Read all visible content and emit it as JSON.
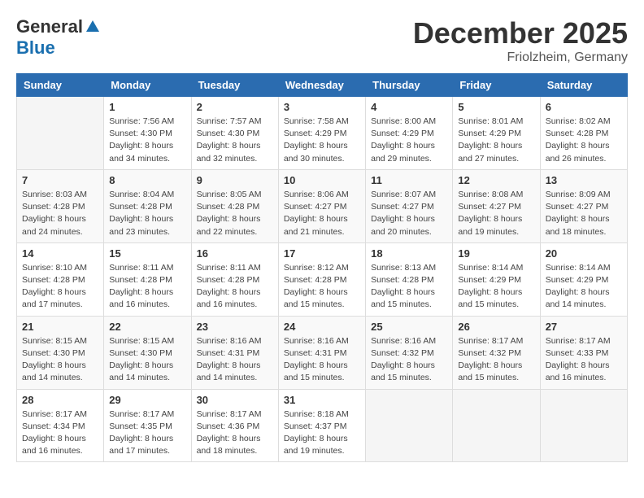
{
  "header": {
    "logo_general": "General",
    "logo_blue": "Blue",
    "month": "December 2025",
    "location": "Friolzheim, Germany"
  },
  "days_of_week": [
    "Sunday",
    "Monday",
    "Tuesday",
    "Wednesday",
    "Thursday",
    "Friday",
    "Saturday"
  ],
  "weeks": [
    [
      {
        "day": "",
        "info": ""
      },
      {
        "day": "1",
        "info": "Sunrise: 7:56 AM\nSunset: 4:30 PM\nDaylight: 8 hours\nand 34 minutes."
      },
      {
        "day": "2",
        "info": "Sunrise: 7:57 AM\nSunset: 4:30 PM\nDaylight: 8 hours\nand 32 minutes."
      },
      {
        "day": "3",
        "info": "Sunrise: 7:58 AM\nSunset: 4:29 PM\nDaylight: 8 hours\nand 30 minutes."
      },
      {
        "day": "4",
        "info": "Sunrise: 8:00 AM\nSunset: 4:29 PM\nDaylight: 8 hours\nand 29 minutes."
      },
      {
        "day": "5",
        "info": "Sunrise: 8:01 AM\nSunset: 4:29 PM\nDaylight: 8 hours\nand 27 minutes."
      },
      {
        "day": "6",
        "info": "Sunrise: 8:02 AM\nSunset: 4:28 PM\nDaylight: 8 hours\nand 26 minutes."
      }
    ],
    [
      {
        "day": "7",
        "info": "Sunrise: 8:03 AM\nSunset: 4:28 PM\nDaylight: 8 hours\nand 24 minutes."
      },
      {
        "day": "8",
        "info": "Sunrise: 8:04 AM\nSunset: 4:28 PM\nDaylight: 8 hours\nand 23 minutes."
      },
      {
        "day": "9",
        "info": "Sunrise: 8:05 AM\nSunset: 4:28 PM\nDaylight: 8 hours\nand 22 minutes."
      },
      {
        "day": "10",
        "info": "Sunrise: 8:06 AM\nSunset: 4:27 PM\nDaylight: 8 hours\nand 21 minutes."
      },
      {
        "day": "11",
        "info": "Sunrise: 8:07 AM\nSunset: 4:27 PM\nDaylight: 8 hours\nand 20 minutes."
      },
      {
        "day": "12",
        "info": "Sunrise: 8:08 AM\nSunset: 4:27 PM\nDaylight: 8 hours\nand 19 minutes."
      },
      {
        "day": "13",
        "info": "Sunrise: 8:09 AM\nSunset: 4:27 PM\nDaylight: 8 hours\nand 18 minutes."
      }
    ],
    [
      {
        "day": "14",
        "info": "Sunrise: 8:10 AM\nSunset: 4:28 PM\nDaylight: 8 hours\nand 17 minutes."
      },
      {
        "day": "15",
        "info": "Sunrise: 8:11 AM\nSunset: 4:28 PM\nDaylight: 8 hours\nand 16 minutes."
      },
      {
        "day": "16",
        "info": "Sunrise: 8:11 AM\nSunset: 4:28 PM\nDaylight: 8 hours\nand 16 minutes."
      },
      {
        "day": "17",
        "info": "Sunrise: 8:12 AM\nSunset: 4:28 PM\nDaylight: 8 hours\nand 15 minutes."
      },
      {
        "day": "18",
        "info": "Sunrise: 8:13 AM\nSunset: 4:28 PM\nDaylight: 8 hours\nand 15 minutes."
      },
      {
        "day": "19",
        "info": "Sunrise: 8:14 AM\nSunset: 4:29 PM\nDaylight: 8 hours\nand 15 minutes."
      },
      {
        "day": "20",
        "info": "Sunrise: 8:14 AM\nSunset: 4:29 PM\nDaylight: 8 hours\nand 14 minutes."
      }
    ],
    [
      {
        "day": "21",
        "info": "Sunrise: 8:15 AM\nSunset: 4:30 PM\nDaylight: 8 hours\nand 14 minutes."
      },
      {
        "day": "22",
        "info": "Sunrise: 8:15 AM\nSunset: 4:30 PM\nDaylight: 8 hours\nand 14 minutes."
      },
      {
        "day": "23",
        "info": "Sunrise: 8:16 AM\nSunset: 4:31 PM\nDaylight: 8 hours\nand 14 minutes."
      },
      {
        "day": "24",
        "info": "Sunrise: 8:16 AM\nSunset: 4:31 PM\nDaylight: 8 hours\nand 15 minutes."
      },
      {
        "day": "25",
        "info": "Sunrise: 8:16 AM\nSunset: 4:32 PM\nDaylight: 8 hours\nand 15 minutes."
      },
      {
        "day": "26",
        "info": "Sunrise: 8:17 AM\nSunset: 4:32 PM\nDaylight: 8 hours\nand 15 minutes."
      },
      {
        "day": "27",
        "info": "Sunrise: 8:17 AM\nSunset: 4:33 PM\nDaylight: 8 hours\nand 16 minutes."
      }
    ],
    [
      {
        "day": "28",
        "info": "Sunrise: 8:17 AM\nSunset: 4:34 PM\nDaylight: 8 hours\nand 16 minutes."
      },
      {
        "day": "29",
        "info": "Sunrise: 8:17 AM\nSunset: 4:35 PM\nDaylight: 8 hours\nand 17 minutes."
      },
      {
        "day": "30",
        "info": "Sunrise: 8:17 AM\nSunset: 4:36 PM\nDaylight: 8 hours\nand 18 minutes."
      },
      {
        "day": "31",
        "info": "Sunrise: 8:18 AM\nSunset: 4:37 PM\nDaylight: 8 hours\nand 19 minutes."
      },
      {
        "day": "",
        "info": ""
      },
      {
        "day": "",
        "info": ""
      },
      {
        "day": "",
        "info": ""
      }
    ]
  ]
}
